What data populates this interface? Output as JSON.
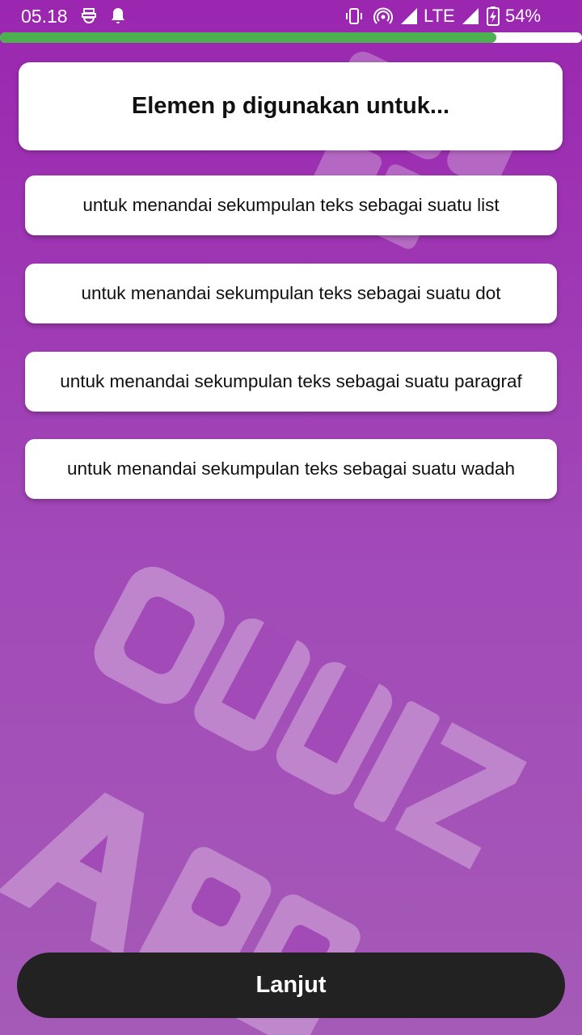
{
  "status_bar": {
    "time": "05.18",
    "network": "LTE",
    "battery": "54%",
    "icons": [
      "usb-debug-icon",
      "notification-bell-icon",
      "vibrate-icon",
      "hotspot-icon",
      "signal-icon",
      "lte-signal-icon",
      "battery-charging-icon"
    ]
  },
  "progress": {
    "fraction": 0.853,
    "track_color": "#ffffff",
    "fill_color": "#4caf50"
  },
  "question": {
    "text": "Elemen p digunakan untuk..."
  },
  "options": [
    {
      "label": "untuk menandai sekumpulan teks sebagai suatu list"
    },
    {
      "label": "untuk menandai sekumpulan teks sebagai suatu dot"
    },
    {
      "label": "untuk menandai sekumpulan teks sebagai suatu paragraf"
    },
    {
      "label": "untuk menandai sekumpulan teks sebagai suatu wadah"
    }
  ],
  "footer": {
    "next_label": "Lanjut"
  },
  "background": {
    "logo_text": "QUUIZ APP",
    "colors": {
      "top": "#9b26b0",
      "bottom": "#a55ab7"
    }
  }
}
